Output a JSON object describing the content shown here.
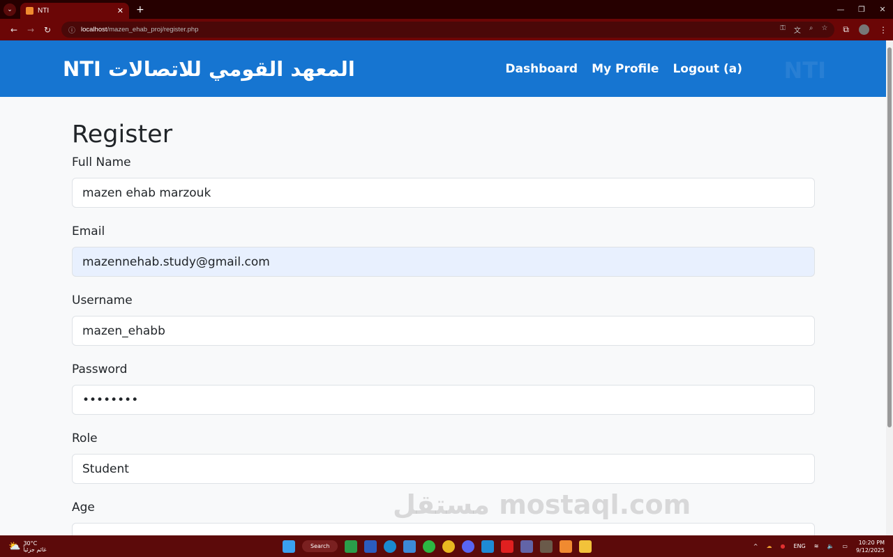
{
  "browser": {
    "tab_title": "NTI",
    "url_host": "localhost",
    "url_path": "/mazen_ehab_proj/register.php"
  },
  "navbar": {
    "brand": "NTI المعهد القومي للاتصالات",
    "links": [
      "Dashboard",
      "My Profile",
      "Logout (a)"
    ],
    "logo_text": "NTI"
  },
  "form": {
    "title": "Register",
    "fields": [
      {
        "label": "Full Name",
        "value": "mazen ehab marzouk"
      },
      {
        "label": "Email",
        "value": "mazennehab.study@gmail.com"
      },
      {
        "label": "Username",
        "value": "mazen_ehabb"
      },
      {
        "label": "Password",
        "value": "••••••••"
      },
      {
        "label": "Role",
        "value": "Student"
      },
      {
        "label": "Age",
        "value": ""
      }
    ]
  },
  "watermark": "مستقل mostaql.com",
  "taskbar": {
    "temp": "30°C",
    "weather": "غائم جزئياً",
    "search": "Search",
    "lang": "ENG",
    "time": "10:20 PM",
    "date": "9/12/2025"
  },
  "colors": {
    "navbar": "#1675d1",
    "browser_frame": "#6b0606"
  }
}
